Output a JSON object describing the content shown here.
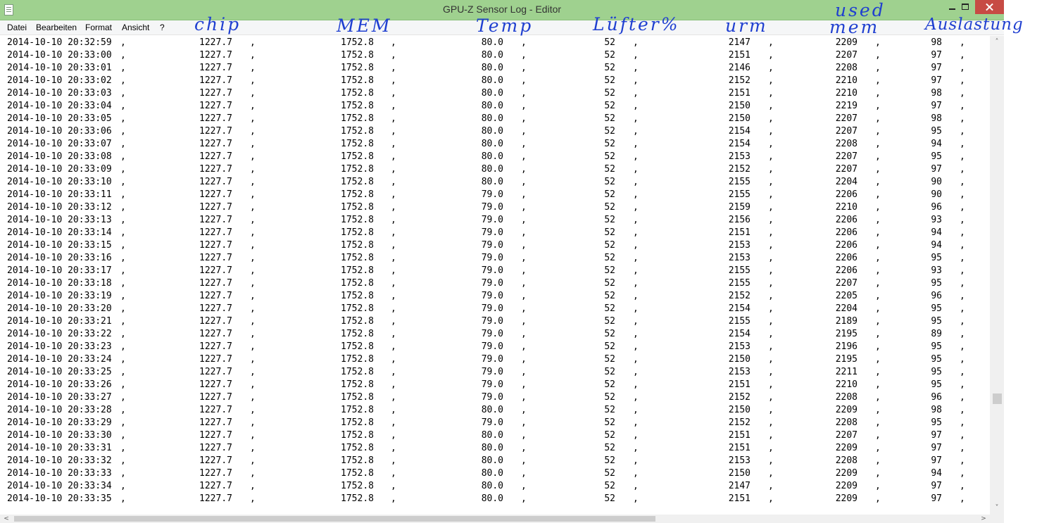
{
  "window": {
    "title": "GPU-Z Sensor Log - Editor"
  },
  "menu": [
    "Datei",
    "Bearbeiten",
    "Format",
    "Ansicht",
    "?"
  ],
  "annotations": {
    "chip": "chip",
    "mem": "MEM",
    "temp": "Temp",
    "luefter": "Lüfter%",
    "urm": "urm",
    "used": "used",
    "mem2": "mem",
    "auslastung": "Auslastung"
  },
  "log": {
    "date": "2014-10-10",
    "delimiter": ",",
    "rows": [
      [
        "20:32:59",
        "1227.7",
        "1752.8",
        "80.0",
        "52",
        "2147",
        "2209",
        "98"
      ],
      [
        "20:33:00",
        "1227.7",
        "1752.8",
        "80.0",
        "52",
        "2151",
        "2207",
        "97"
      ],
      [
        "20:33:01",
        "1227.7",
        "1752.8",
        "80.0",
        "52",
        "2146",
        "2208",
        "97"
      ],
      [
        "20:33:02",
        "1227.7",
        "1752.8",
        "80.0",
        "52",
        "2152",
        "2210",
        "97"
      ],
      [
        "20:33:03",
        "1227.7",
        "1752.8",
        "80.0",
        "52",
        "2151",
        "2210",
        "98"
      ],
      [
        "20:33:04",
        "1227.7",
        "1752.8",
        "80.0",
        "52",
        "2150",
        "2219",
        "97"
      ],
      [
        "20:33:05",
        "1227.7",
        "1752.8",
        "80.0",
        "52",
        "2150",
        "2207",
        "98"
      ],
      [
        "20:33:06",
        "1227.7",
        "1752.8",
        "80.0",
        "52",
        "2154",
        "2207",
        "95"
      ],
      [
        "20:33:07",
        "1227.7",
        "1752.8",
        "80.0",
        "52",
        "2154",
        "2208",
        "94"
      ],
      [
        "20:33:08",
        "1227.7",
        "1752.8",
        "80.0",
        "52",
        "2153",
        "2207",
        "95"
      ],
      [
        "20:33:09",
        "1227.7",
        "1752.8",
        "80.0",
        "52",
        "2152",
        "2207",
        "97"
      ],
      [
        "20:33:10",
        "1227.7",
        "1752.8",
        "80.0",
        "52",
        "2155",
        "2204",
        "90"
      ],
      [
        "20:33:11",
        "1227.7",
        "1752.8",
        "79.0",
        "52",
        "2155",
        "2206",
        "90"
      ],
      [
        "20:33:12",
        "1227.7",
        "1752.8",
        "79.0",
        "52",
        "2159",
        "2210",
        "96"
      ],
      [
        "20:33:13",
        "1227.7",
        "1752.8",
        "79.0",
        "52",
        "2156",
        "2206",
        "93"
      ],
      [
        "20:33:14",
        "1227.7",
        "1752.8",
        "79.0",
        "52",
        "2151",
        "2206",
        "94"
      ],
      [
        "20:33:15",
        "1227.7",
        "1752.8",
        "79.0",
        "52",
        "2153",
        "2206",
        "94"
      ],
      [
        "20:33:16",
        "1227.7",
        "1752.8",
        "79.0",
        "52",
        "2153",
        "2206",
        "95"
      ],
      [
        "20:33:17",
        "1227.7",
        "1752.8",
        "79.0",
        "52",
        "2155",
        "2206",
        "93"
      ],
      [
        "20:33:18",
        "1227.7",
        "1752.8",
        "79.0",
        "52",
        "2155",
        "2207",
        "95"
      ],
      [
        "20:33:19",
        "1227.7",
        "1752.8",
        "79.0",
        "52",
        "2152",
        "2205",
        "96"
      ],
      [
        "20:33:20",
        "1227.7",
        "1752.8",
        "79.0",
        "52",
        "2154",
        "2204",
        "95"
      ],
      [
        "20:33:21",
        "1227.7",
        "1752.8",
        "79.0",
        "52",
        "2155",
        "2189",
        "95"
      ],
      [
        "20:33:22",
        "1227.7",
        "1752.8",
        "79.0",
        "52",
        "2154",
        "2195",
        "89"
      ],
      [
        "20:33:23",
        "1227.7",
        "1752.8",
        "79.0",
        "52",
        "2153",
        "2196",
        "95"
      ],
      [
        "20:33:24",
        "1227.7",
        "1752.8",
        "79.0",
        "52",
        "2150",
        "2195",
        "95"
      ],
      [
        "20:33:25",
        "1227.7",
        "1752.8",
        "79.0",
        "52",
        "2153",
        "2211",
        "95"
      ],
      [
        "20:33:26",
        "1227.7",
        "1752.8",
        "79.0",
        "52",
        "2151",
        "2210",
        "95"
      ],
      [
        "20:33:27",
        "1227.7",
        "1752.8",
        "79.0",
        "52",
        "2152",
        "2208",
        "96"
      ],
      [
        "20:33:28",
        "1227.7",
        "1752.8",
        "80.0",
        "52",
        "2150",
        "2209",
        "98"
      ],
      [
        "20:33:29",
        "1227.7",
        "1752.8",
        "79.0",
        "52",
        "2152",
        "2208",
        "95"
      ],
      [
        "20:33:30",
        "1227.7",
        "1752.8",
        "80.0",
        "52",
        "2151",
        "2207",
        "97"
      ],
      [
        "20:33:31",
        "1227.7",
        "1752.8",
        "80.0",
        "52",
        "2151",
        "2209",
        "97"
      ],
      [
        "20:33:32",
        "1227.7",
        "1752.8",
        "80.0",
        "52",
        "2153",
        "2208",
        "97"
      ],
      [
        "20:33:33",
        "1227.7",
        "1752.8",
        "80.0",
        "52",
        "2150",
        "2209",
        "94"
      ],
      [
        "20:33:34",
        "1227.7",
        "1752.8",
        "80.0",
        "52",
        "2147",
        "2209",
        "97"
      ],
      [
        "20:33:35",
        "1227.7",
        "1752.8",
        "80.0",
        "52",
        "2151",
        "2209",
        "97"
      ]
    ]
  }
}
